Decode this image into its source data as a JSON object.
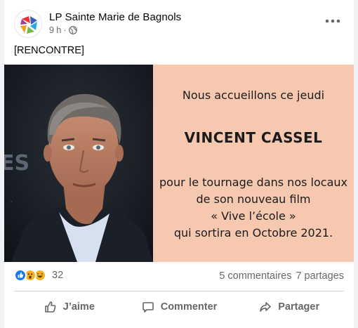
{
  "post": {
    "page_name": "LP Sainte Marie de Bagnols",
    "time": "9 h",
    "separator": "·",
    "text": "[RENCONTRE]",
    "more_icon": "more-horizontal-icon",
    "privacy_icon": "globe-icon"
  },
  "image": {
    "line1": "Nous accueillons ce jeudi",
    "line2": "VINCENT CASSEL",
    "line3a": "pour le tournage dans nos locaux",
    "line3b": "de son nouveau film",
    "line3c": "« Vive l’école »",
    "line3d": "qui sortira en Octobre 2021.",
    "background": "#f6c8b0"
  },
  "stats": {
    "reaction_icons": [
      "like-icon",
      "wow-icon",
      "haha-icon"
    ],
    "reaction_count": "32",
    "comments": "5 commentaires",
    "shares": "7 partages"
  },
  "actions": {
    "like": "J’aime",
    "comment": "Commenter",
    "share": "Partager"
  },
  "colors": {
    "secondary_text": "#65676b",
    "like_blue": "#1877f2",
    "reaction_yellow": "#f7b125"
  }
}
